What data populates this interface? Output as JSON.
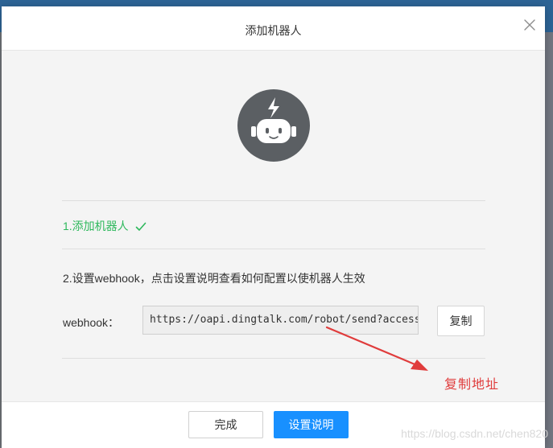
{
  "dialog": {
    "title": "添加机器人"
  },
  "steps": {
    "step1_label": "1.添加机器人",
    "step2_label": "2.设置webhook，点击设置说明查看如何配置以使机器人生效"
  },
  "webhook": {
    "label": "webhook：",
    "value": "https://oapi.dingtalk.com/robot/send?access_token=",
    "copy_label": "复制"
  },
  "annotation": {
    "text": "复制地址",
    "color": "#e03c3c"
  },
  "footer": {
    "done_label": "完成",
    "settings_label": "设置说明"
  },
  "watermark": "https://blog.csdn.net/chen820",
  "colors": {
    "primary": "#1890ff",
    "success": "#2eb85c",
    "robot_avatar": "#5b5f63"
  },
  "icons": {
    "close": "close-icon",
    "check": "check-icon",
    "robot": "robot-icon"
  }
}
